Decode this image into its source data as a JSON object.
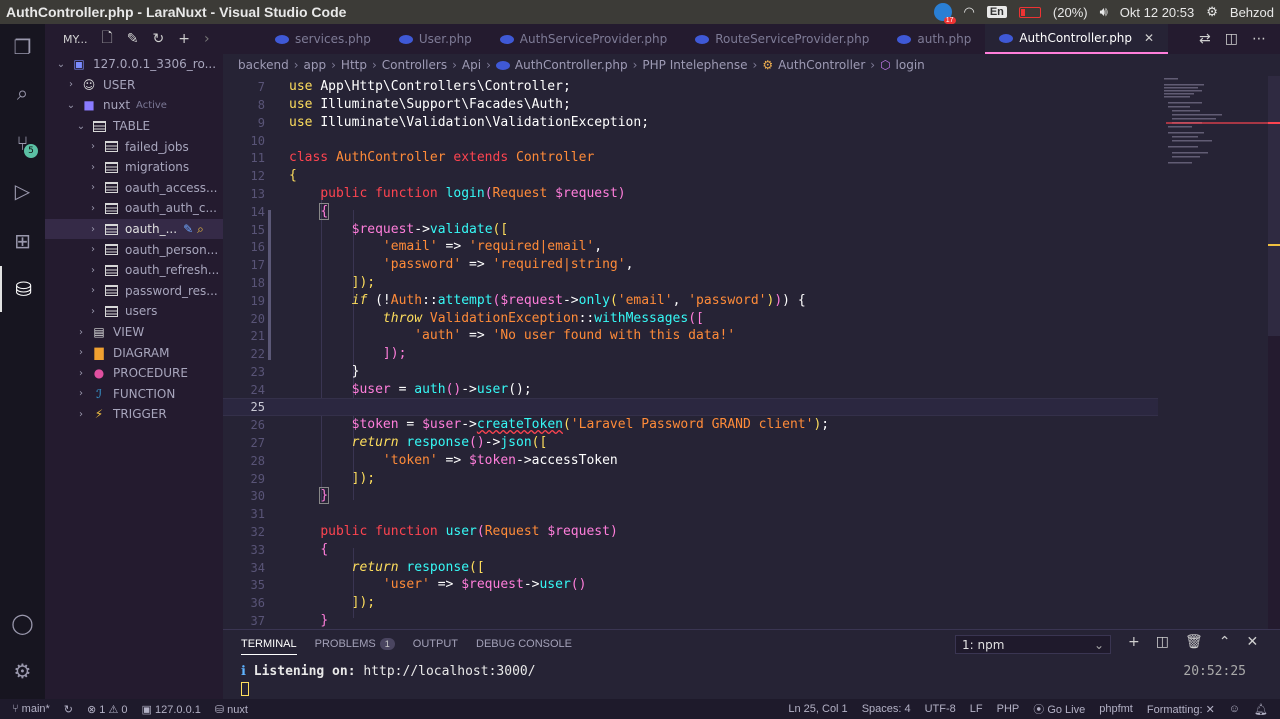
{
  "os": {
    "window_title": "AuthController.php - LaraNuxt - Visual Studio Code",
    "app_badge": "17",
    "lang": "En",
    "battery": "(20%)",
    "clock": "Okt 12 20:53",
    "user": "Behzod"
  },
  "activity": {
    "extensions_badge": "5"
  },
  "sidebar": {
    "header": "MY...",
    "connection": "127.0.0.1_3306_ro...",
    "items": [
      {
        "label": "USER"
      },
      {
        "label": "nuxt",
        "tag": "Active"
      },
      {
        "label": "TABLE"
      },
      {
        "label": "failed_jobs"
      },
      {
        "label": "migrations"
      },
      {
        "label": "oauth_access..."
      },
      {
        "label": "oauth_auth_c..."
      },
      {
        "label": "oauth_..."
      },
      {
        "label": "oauth_person..."
      },
      {
        "label": "oauth_refresh..."
      },
      {
        "label": "password_res..."
      },
      {
        "label": "users"
      },
      {
        "label": "VIEW"
      },
      {
        "label": "DIAGRAM"
      },
      {
        "label": "PROCEDURE"
      },
      {
        "label": "FUNCTION"
      },
      {
        "label": "TRIGGER"
      }
    ]
  },
  "tabs": [
    {
      "label": "services.php"
    },
    {
      "label": "User.php"
    },
    {
      "label": "AuthServiceProvider.php"
    },
    {
      "label": "RouteServiceProvider.php"
    },
    {
      "label": "auth.php"
    },
    {
      "label": "AuthController.php"
    }
  ],
  "breadcrumb": [
    "backend",
    "app",
    "Http",
    "Controllers",
    "Api",
    "AuthController.php",
    "PHP Intelephense",
    "AuthController",
    "login"
  ],
  "editor": {
    "line_numbers": [
      "7",
      "8",
      "9",
      "10",
      "11",
      "12",
      "13",
      "14",
      "15",
      "16",
      "17",
      "18",
      "19",
      "20",
      "21",
      "22",
      "23",
      "24",
      "25",
      "26",
      "27",
      "28",
      "29",
      "30",
      "31",
      "32",
      "33",
      "34",
      "35",
      "36",
      "37"
    ]
  },
  "panel": {
    "tabs": [
      "TERMINAL",
      "PROBLEMS",
      "OUTPUT",
      "DEBUG CONSOLE"
    ],
    "problems_count": "1",
    "terminal_select": "1: npm",
    "listening_label": "Listening on:",
    "listening_url": "http://localhost:3000/",
    "time": "20:52:25"
  },
  "status": {
    "branch": "main*",
    "errors": "1",
    "warnings": "0",
    "db": "127.0.0.1",
    "db_name": "nuxt",
    "position": "Ln 25, Col 1",
    "spaces": "Spaces: 4",
    "encoding": "UTF-8",
    "eol": "LF",
    "language": "PHP",
    "golive": "Go Live",
    "fmt": "phpfmt",
    "formatting": "Formatting:"
  }
}
